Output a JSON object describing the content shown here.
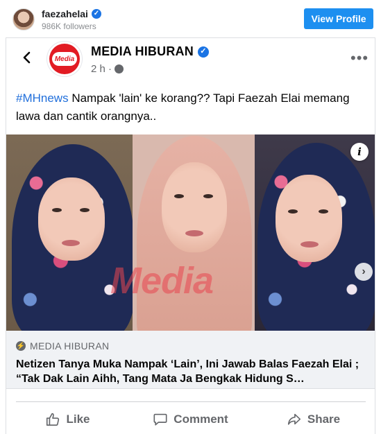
{
  "profile": {
    "username": "faezahelai",
    "followers": "986K followers",
    "view_profile_label": "View Profile"
  },
  "post": {
    "page_name": "MEDIA HIBURAN",
    "logo_text": "Media",
    "time": "2 h ·",
    "caption_hashtag": "#MHnews",
    "caption_text": " Nampak 'lain' ke korang?? Tapi Faezah Elai memang lawa dan cantik orangnya..",
    "more_label": "•••"
  },
  "photo": {
    "watermark": "Media",
    "info_label": "i",
    "next_label": "›"
  },
  "link_preview": {
    "source": "MEDIA HIBURAN",
    "title": "Netizen Tanya Muka Nampak ‘Lain’, Ini Jawab Balas Faezah Elai ; “Tak Dak Lain Aihh, Tang Mata Ja Bengkak Hidung S…"
  },
  "actions": {
    "like": "Like",
    "comment": "Comment",
    "share": "Share"
  },
  "icons": {
    "verified": "verified-badge-icon",
    "back": "back-arrow-icon",
    "globe": "globe-icon",
    "more": "more-options-icon",
    "info": "info-icon",
    "next": "chevron-right-icon",
    "bolt": "instant-article-icon",
    "like": "thumbs-up-icon",
    "comment": "speech-bubble-icon",
    "share": "share-arrow-icon"
  },
  "colors": {
    "brand_blue": "#1d8ff0",
    "link_blue": "#216fdb",
    "verified_blue": "#1b74e4",
    "logo_red": "#e21b23"
  }
}
